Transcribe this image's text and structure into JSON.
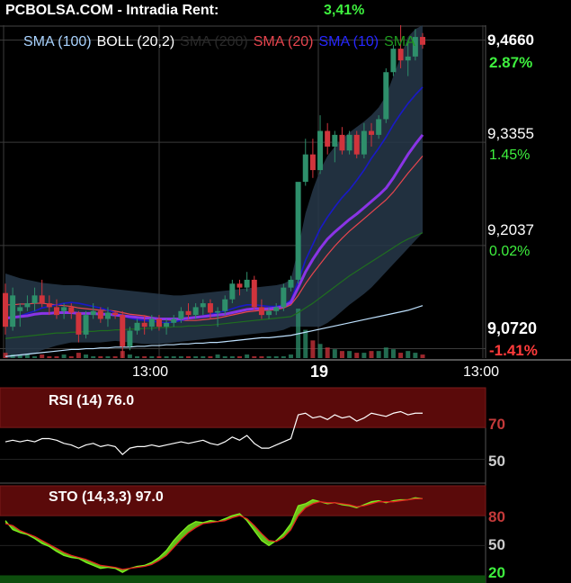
{
  "header": {
    "title": "PCBOLSA.COM - Intradia  Rent:",
    "rent": "3,41%"
  },
  "colors": {
    "bg": "#000000",
    "up": "#2e8f6b",
    "down": "#d0343c",
    "band": "#27384a",
    "sma100": "#bfe2ff",
    "sma200": "#1f6e1f",
    "sma20": "#e8454e",
    "sma10": "#1919c8",
    "boll_mid": "#8a34e6",
    "green_text": "#3ef03e",
    "red_text": "#ff3b3b",
    "panel_band": "#5a0a0a",
    "sto_fast": "#7cf01e",
    "sto_slow": "#e32020"
  },
  "legend": [
    {
      "label": "SMA (100)",
      "color": "#a9d3ff"
    },
    {
      "label": "BOLL (20,2)",
      "color": "#ffffff"
    },
    {
      "label": "SMA (200)",
      "color": "#2a2a2a"
    },
    {
      "label": "SMA (20)",
      "color": "#e8454e"
    },
    {
      "label": "SMA (10)",
      "color": "#2727ff"
    },
    {
      "label": "SMA",
      "color": "#1f9a1f"
    }
  ],
  "price_axis": {
    "labels": [
      "9,4660",
      "9,3355",
      "9,2037",
      "9,0720"
    ],
    "levels": [
      9.466,
      9.3355,
      9.2037,
      9.072
    ],
    "pct": [
      "2.87%",
      "1.45%",
      "0.02%",
      "-1.41%"
    ],
    "pct_colors": [
      "#3ef03e",
      "#3ef03e",
      "#3ef03e",
      "#ff3b3b"
    ]
  },
  "time_axis": {
    "labels": [
      "13:00",
      "19",
      "13:00"
    ]
  },
  "chart_data": {
    "type": "candlestick",
    "ylim": [
      9.06,
      9.485
    ],
    "candles": [
      [
        9.143,
        9.155,
        9.09,
        9.1
      ],
      [
        9.1,
        9.15,
        9.095,
        9.14
      ],
      [
        9.12,
        9.13,
        9.1,
        9.125
      ],
      [
        9.125,
        9.14,
        9.12,
        9.13
      ],
      [
        9.13,
        9.15,
        9.12,
        9.14
      ],
      [
        9.14,
        9.16,
        9.125,
        9.13
      ],
      [
        9.13,
        9.14,
        9.115,
        9.125
      ],
      [
        9.125,
        9.135,
        9.11,
        9.115
      ],
      [
        9.12,
        9.13,
        9.11,
        9.125
      ],
      [
        9.125,
        9.13,
        9.11,
        9.118
      ],
      [
        9.118,
        9.12,
        9.08,
        9.09
      ],
      [
        9.09,
        9.12,
        9.085,
        9.115
      ],
      [
        9.115,
        9.13,
        9.11,
        9.12
      ],
      [
        9.12,
        9.125,
        9.105,
        9.11
      ],
      [
        9.11,
        9.125,
        9.1,
        9.118
      ],
      [
        9.118,
        9.12,
        9.11,
        9.115
      ],
      [
        9.115,
        9.12,
        9.06,
        9.075
      ],
      [
        9.075,
        9.1,
        9.07,
        9.095
      ],
      [
        9.095,
        9.11,
        9.09,
        9.105
      ],
      [
        9.105,
        9.115,
        9.09,
        9.1
      ],
      [
        9.1,
        9.115,
        9.095,
        9.11
      ],
      [
        9.11,
        9.115,
        9.095,
        9.1
      ],
      [
        9.1,
        9.11,
        9.09,
        9.105
      ],
      [
        9.105,
        9.115,
        9.1,
        9.11
      ],
      [
        9.11,
        9.125,
        9.105,
        9.12
      ],
      [
        9.12,
        9.13,
        9.11,
        9.115
      ],
      [
        9.115,
        9.13,
        9.11,
        9.125
      ],
      [
        9.125,
        9.135,
        9.115,
        9.13
      ],
      [
        9.13,
        9.135,
        9.11,
        9.118
      ],
      [
        9.118,
        9.125,
        9.1,
        9.12
      ],
      [
        9.12,
        9.14,
        9.115,
        9.135
      ],
      [
        9.135,
        9.16,
        9.13,
        9.155
      ],
      [
        9.155,
        9.16,
        9.14,
        9.15
      ],
      [
        9.15,
        9.17,
        9.145,
        9.16
      ],
      [
        9.16,
        9.165,
        9.12,
        9.125
      ],
      [
        9.125,
        9.135,
        9.11,
        9.115
      ],
      [
        9.115,
        9.125,
        9.11,
        9.12
      ],
      [
        9.12,
        9.13,
        9.115,
        9.125
      ],
      [
        9.125,
        9.155,
        9.12,
        9.15
      ],
      [
        9.15,
        9.165,
        9.145,
        9.16
      ],
      [
        9.16,
        9.2,
        9.155,
        9.285
      ],
      [
        9.285,
        9.34,
        9.28,
        9.32
      ],
      [
        9.32,
        9.34,
        9.29,
        9.3
      ],
      [
        9.3,
        9.37,
        9.295,
        9.35
      ],
      [
        9.35,
        9.36,
        9.32,
        9.33
      ],
      [
        9.33,
        9.35,
        9.31,
        9.345
      ],
      [
        9.345,
        9.355,
        9.32,
        9.325
      ],
      [
        9.325,
        9.35,
        9.32,
        9.345
      ],
      [
        9.345,
        9.35,
        9.315,
        9.32
      ],
      [
        9.32,
        9.36,
        9.315,
        9.35
      ],
      [
        9.35,
        9.36,
        9.33,
        9.345
      ],
      [
        9.345,
        9.37,
        9.34,
        9.365
      ],
      [
        9.365,
        9.43,
        9.36,
        9.425
      ],
      [
        9.425,
        9.46,
        9.42,
        9.455
      ],
      [
        9.455,
        9.485,
        9.43,
        9.44
      ],
      [
        9.44,
        9.465,
        9.42,
        9.445
      ],
      [
        9.445,
        9.48,
        9.44,
        9.47
      ],
      [
        9.47,
        9.475,
        9.455,
        9.46
      ]
    ],
    "sma100": [
      9.062,
      9.063,
      9.064,
      9.065,
      9.066,
      9.067,
      9.068,
      9.069,
      9.07,
      9.071,
      9.071,
      9.072,
      9.072,
      9.073,
      9.073,
      9.074,
      9.074,
      9.074,
      9.075,
      9.075,
      9.076,
      9.076,
      9.077,
      9.077,
      9.078,
      9.078,
      9.079,
      9.079,
      9.08,
      9.08,
      9.081,
      9.082,
      9.083,
      9.084,
      9.085,
      9.086,
      9.086,
      9.087,
      9.088,
      9.089,
      9.091,
      9.093,
      9.095,
      9.097,
      9.099,
      9.101,
      9.103,
      9.105,
      9.107,
      9.109,
      9.111,
      9.113,
      9.115,
      9.117,
      9.119,
      9.121,
      9.124,
      9.127
    ],
    "sma200": [
      9.085,
      9.086,
      9.087,
      9.088,
      9.089,
      9.09,
      9.091,
      9.092,
      9.092,
      9.093,
      9.093,
      9.094,
      9.094,
      9.095,
      9.095,
      9.096,
      9.096,
      9.097,
      9.097,
      9.098,
      9.098,
      9.099,
      9.099,
      9.1,
      9.1,
      9.101,
      9.101,
      9.102,
      9.102,
      9.103,
      9.104,
      9.105,
      9.106,
      9.107,
      9.108,
      9.109,
      9.11,
      9.111,
      9.112,
      9.113,
      9.118,
      9.124,
      9.13,
      9.137,
      9.144,
      9.151,
      9.158,
      9.165,
      9.171,
      9.177,
      9.183,
      9.189,
      9.195,
      9.201,
      9.207,
      9.212,
      9.216,
      9.22
    ],
    "sma20": [
      9.128,
      9.128,
      9.129,
      9.129,
      9.13,
      9.13,
      9.129,
      9.128,
      9.127,
      9.126,
      9.124,
      9.123,
      9.122,
      9.121,
      9.121,
      9.12,
      9.118,
      9.116,
      9.115,
      9.114,
      9.112,
      9.11,
      9.109,
      9.108,
      9.108,
      9.108,
      9.108,
      9.109,
      9.11,
      9.111,
      9.113,
      9.115,
      9.117,
      9.119,
      9.12,
      9.121,
      9.121,
      9.122,
      9.124,
      9.128,
      9.14,
      9.155,
      9.168,
      9.18,
      9.192,
      9.203,
      9.213,
      9.222,
      9.23,
      9.238,
      9.246,
      9.254,
      9.262,
      9.272,
      9.284,
      9.296,
      9.307,
      9.318
    ],
    "boll_mid": [
      9.111,
      9.112,
      9.113,
      9.114,
      9.116,
      9.117,
      9.117,
      9.118,
      9.118,
      9.118,
      9.117,
      9.117,
      9.117,
      9.116,
      9.116,
      9.115,
      9.114,
      9.113,
      9.112,
      9.111,
      9.111,
      9.11,
      9.11,
      9.11,
      9.11,
      9.111,
      9.112,
      9.113,
      9.114,
      9.115,
      9.116,
      9.118,
      9.12,
      9.122,
      9.123,
      9.123,
      9.123,
      9.124,
      9.126,
      9.131,
      9.15,
      9.17,
      9.186,
      9.2,
      9.212,
      9.221,
      9.229,
      9.237,
      9.244,
      9.252,
      9.26,
      9.268,
      9.277,
      9.29,
      9.305,
      9.32,
      9.333,
      9.345
    ],
    "sma10": [
      9.11,
      9.112,
      9.114,
      9.117,
      9.12,
      9.124,
      9.126,
      9.128,
      9.13,
      9.131,
      9.13,
      9.128,
      9.126,
      9.124,
      9.121,
      9.118,
      9.114,
      9.111,
      9.109,
      9.108,
      9.107,
      9.106,
      9.105,
      9.106,
      9.108,
      9.11,
      9.112,
      9.114,
      9.116,
      9.118,
      9.12,
      9.123,
      9.126,
      9.128,
      9.128,
      9.127,
      9.126,
      9.126,
      9.128,
      9.134,
      9.158,
      9.185,
      9.205,
      9.225,
      9.24,
      9.253,
      9.265,
      9.275,
      9.287,
      9.3,
      9.315,
      9.328,
      9.342,
      9.358,
      9.372,
      9.385,
      9.396,
      9.406
    ],
    "boll_upper": [
      9.168,
      9.165,
      9.162,
      9.16,
      9.158,
      9.156,
      9.155,
      9.154,
      9.153,
      9.153,
      9.153,
      9.152,
      9.151,
      9.15,
      9.149,
      9.148,
      9.147,
      9.146,
      9.145,
      9.144,
      9.143,
      9.142,
      9.141,
      9.14,
      9.14,
      9.141,
      9.142,
      9.143,
      9.144,
      9.145,
      9.146,
      9.147,
      9.148,
      9.149,
      9.15,
      9.151,
      9.152,
      9.153,
      9.155,
      9.16,
      9.2,
      9.245,
      9.275,
      9.3,
      9.318,
      9.33,
      9.34,
      9.348,
      9.355,
      9.362,
      9.37,
      9.38,
      9.395,
      9.42,
      9.445,
      9.47,
      9.48,
      9.485
    ],
    "boll_lower": [
      9.06,
      9.06,
      9.061,
      9.063,
      9.066,
      9.07,
      9.073,
      9.076,
      9.078,
      9.08,
      9.08,
      9.08,
      9.08,
      9.08,
      9.081,
      9.082,
      9.081,
      9.08,
      9.079,
      9.078,
      9.078,
      9.078,
      9.079,
      9.08,
      9.081,
      9.082,
      9.083,
      9.084,
      9.085,
      9.086,
      9.087,
      9.088,
      9.089,
      9.09,
      9.091,
      9.092,
      9.093,
      9.094,
      9.096,
      9.1,
      9.1,
      9.1,
      9.1,
      9.1,
      9.105,
      9.112,
      9.12,
      9.128,
      9.135,
      9.142,
      9.15,
      9.16,
      9.17,
      9.18,
      9.19,
      9.2,
      9.21,
      9.22
    ],
    "volume": [
      3,
      2,
      2,
      2,
      1,
      2,
      1,
      1,
      2,
      1,
      3,
      2,
      1,
      1,
      1,
      1,
      4,
      2,
      1,
      1,
      1,
      1,
      1,
      1,
      1,
      1,
      1,
      1,
      1,
      2,
      1,
      1,
      1,
      2,
      1,
      1,
      1,
      1,
      1,
      2,
      28,
      16,
      10,
      8,
      6,
      5,
      4,
      4,
      3,
      3,
      4,
      4,
      6,
      5,
      3,
      4,
      3,
      2
    ],
    "rsi": {
      "label": "RSI (14) 76.0",
      "ylim": [
        35,
        95
      ],
      "levels": [
        70,
        50
      ],
      "level_labels": [
        "70",
        "50"
      ],
      "values": [
        61,
        62,
        61,
        62,
        61,
        63,
        63,
        62,
        60,
        59,
        57,
        59,
        60,
        58,
        59,
        58,
        53,
        57,
        58,
        58,
        59,
        58,
        59,
        60,
        61,
        60,
        61,
        62,
        60,
        59,
        61,
        64,
        62,
        65,
        60,
        57,
        57,
        59,
        61,
        63,
        78,
        79,
        76,
        77,
        75,
        78,
        76,
        77,
        74,
        76,
        79,
        78,
        77,
        79,
        80,
        78,
        79,
        79
      ]
    },
    "sto": {
      "label": "STO (14,3,3) 97.0",
      "ylim": [
        15,
        110
      ],
      "levels": [
        80,
        50,
        20
      ],
      "level_labels": [
        "80",
        "50",
        "20"
      ],
      "fast": [
        75,
        66,
        63,
        61,
        57,
        52,
        49,
        44,
        40,
        38,
        37,
        33,
        30,
        27,
        28,
        27,
        23,
        27,
        29,
        30,
        33,
        38,
        45,
        55,
        63,
        70,
        74,
        73,
        75,
        74,
        77,
        80,
        82,
        75,
        65,
        55,
        50,
        55,
        62,
        72,
        90,
        92,
        96,
        94,
        92,
        93,
        91,
        90,
        88,
        91,
        94,
        95,
        93,
        95,
        96,
        96,
        98,
        97
      ],
      "slow": [
        72,
        70,
        65,
        62,
        59,
        55,
        51,
        47,
        43,
        40,
        38,
        36,
        33,
        30,
        29,
        28,
        26,
        27,
        28,
        29,
        31,
        35,
        40,
        48,
        56,
        63,
        68,
        72,
        73,
        74,
        75,
        78,
        80,
        77,
        70,
        62,
        55,
        54,
        58,
        66,
        80,
        88,
        92,
        94,
        93,
        93,
        92,
        91,
        89,
        90,
        92,
        94,
        94,
        94,
        95,
        96,
        97,
        97
      ]
    }
  }
}
